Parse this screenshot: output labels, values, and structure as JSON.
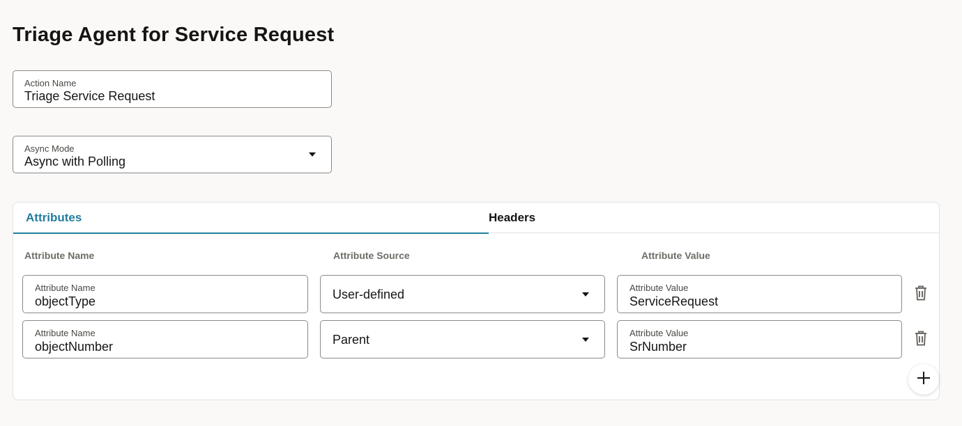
{
  "page": {
    "title": "Triage Agent for Service Request"
  },
  "action_name": {
    "label": "Action Name",
    "value": "Triage Service Request"
  },
  "async_mode": {
    "label": "Async Mode",
    "value": "Async with Polling"
  },
  "tabs": [
    {
      "label": "Attributes",
      "active": true
    },
    {
      "label": "Headers",
      "active": false
    }
  ],
  "columns": {
    "name": "Attribute Name",
    "source": "Attribute Source",
    "value": "Attribute Value"
  },
  "rows": [
    {
      "name_label": "Attribute Name",
      "name": "objectType",
      "source": "User-defined",
      "value_label": "Attribute Value",
      "value": "ServiceRequest"
    },
    {
      "name_label": "Attribute Name",
      "name": "objectNumber",
      "source": "Parent",
      "value_label": "Attribute Value",
      "value": "SrNumber"
    }
  ],
  "icons": {
    "dropdown": "chevron-down-icon",
    "delete": "trash-icon",
    "add": "plus-icon"
  },
  "colors": {
    "accent": "#227e9e",
    "background": "#faf9f8"
  }
}
